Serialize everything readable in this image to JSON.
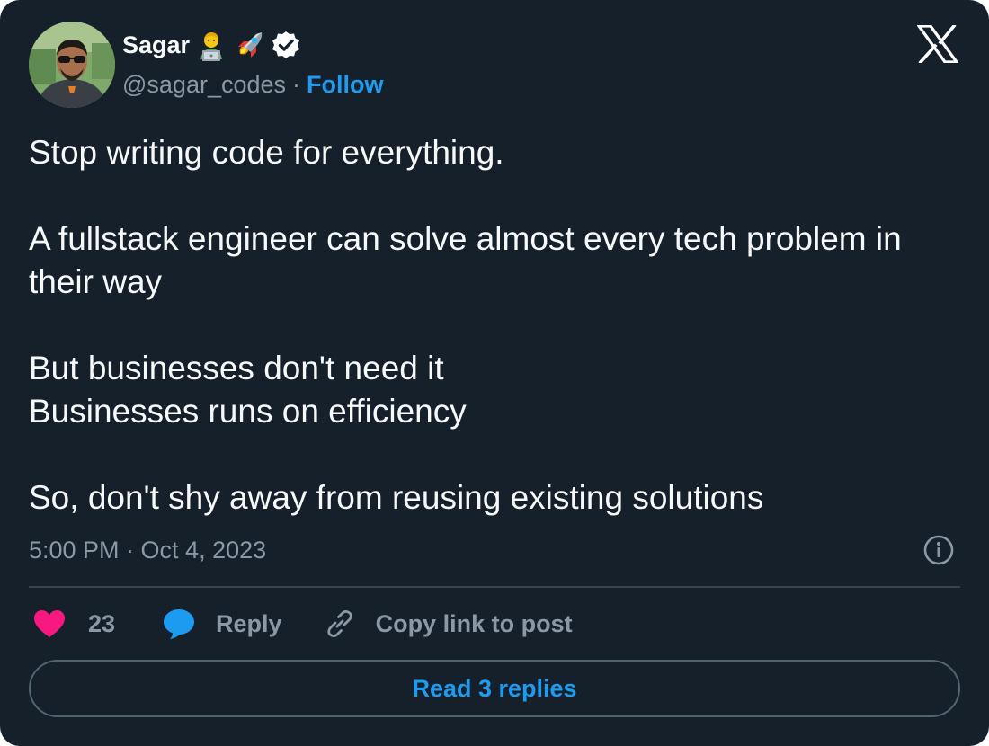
{
  "author": {
    "display_name": "Sagar",
    "handle": "@sagar_codes",
    "separator": "·",
    "follow_label": "Follow",
    "badges": [
      "technologist-emoji",
      "rocket-emoji",
      "verified-badge"
    ]
  },
  "tweet": {
    "lines": [
      "Stop writing code for everything.",
      "",
      "A fullstack engineer can solve almost every tech problem in their way",
      "",
      "But businesses don't need it",
      "Businesses runs on efficiency",
      "",
      "So, don't shy away from reusing existing solutions"
    ],
    "timestamp": "5:00 PM · Oct 4, 2023"
  },
  "actions": {
    "like_count": "23",
    "reply_label": "Reply",
    "copy_link_label": "Copy link to post",
    "read_replies_label": "Read 3 replies"
  },
  "colors": {
    "background": "#15202b",
    "text": "#f7f9f9",
    "secondary_text": "#8b98a5",
    "accent": "#1d9bf0",
    "like": "#f91880",
    "divider": "#38444d"
  },
  "icons": {
    "logo": "x-logo-icon",
    "info": "info-icon",
    "like": "heart-icon",
    "reply": "speech-bubble-icon",
    "copy": "link-icon"
  }
}
